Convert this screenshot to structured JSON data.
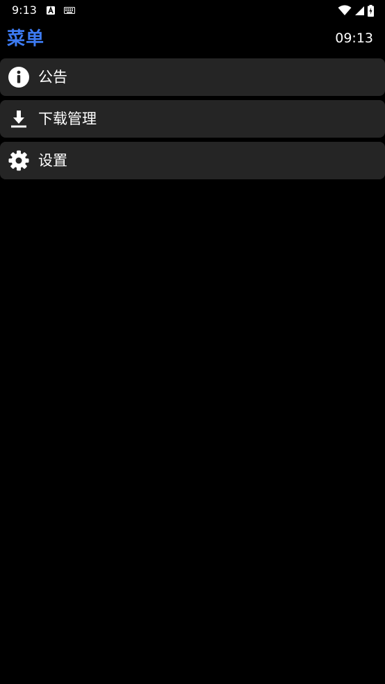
{
  "status_bar": {
    "time": "9:13",
    "icons": [
      "a-notification-icon",
      "keyboard-icon",
      "wifi-icon",
      "cell-signal-icon",
      "battery-icon"
    ]
  },
  "header": {
    "title": "菜单",
    "clock": "09:13",
    "title_color": "#3d7bf2"
  },
  "menu": {
    "items": [
      {
        "label": "公告",
        "icon": "info-icon"
      },
      {
        "label": "下载管理",
        "icon": "download-icon"
      },
      {
        "label": "设置",
        "icon": "gear-icon"
      }
    ]
  },
  "colors": {
    "background": "#000000",
    "item_background": "#252525",
    "text": "#ffffff",
    "accent": "#3d7bf2"
  }
}
